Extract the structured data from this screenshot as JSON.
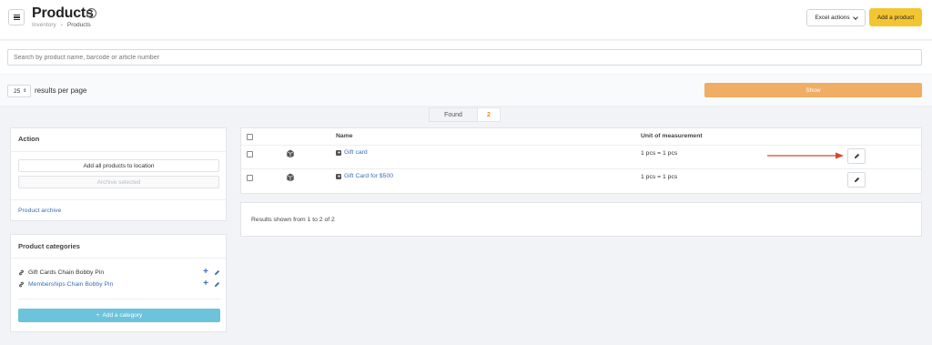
{
  "header": {
    "title": "Products",
    "info_icon": "info-icon",
    "breadcrumb": [
      "Inventory",
      "Products"
    ],
    "excel_actions_label": "Excel actions",
    "add_product_label": "Add a product",
    "accent_color": "#f4c533"
  },
  "search": {
    "placeholder": "Search by product name, barcode or article number",
    "value": ""
  },
  "pagination": {
    "per_page_value": "25",
    "per_page_label": "results per page",
    "show_label": "Show"
  },
  "found": {
    "label": "Found",
    "count": "2"
  },
  "action_panel": {
    "title": "Action",
    "buttons": [
      "Add all products to location",
      "Archive selected"
    ],
    "archive_link": "Product archive"
  },
  "categories_panel": {
    "title": "Product categories",
    "items": [
      {
        "name": "Gift Cards Chain Bobby Pin",
        "linked": false
      },
      {
        "name": "Memberships Chain Bobby Pin",
        "linked": true
      }
    ],
    "add_label": "Add a category",
    "add_color": "#6cc3db"
  },
  "table": {
    "columns": [
      "Name",
      "Unit of measurement"
    ],
    "rows": [
      {
        "name": "Gift card",
        "unit": "1 pcs = 1 pcs"
      },
      {
        "name": "Gift Card for $500",
        "unit": "1 pcs = 1 pcs"
      }
    ]
  },
  "results_text": "Results shown from 1 to 2 of 2"
}
